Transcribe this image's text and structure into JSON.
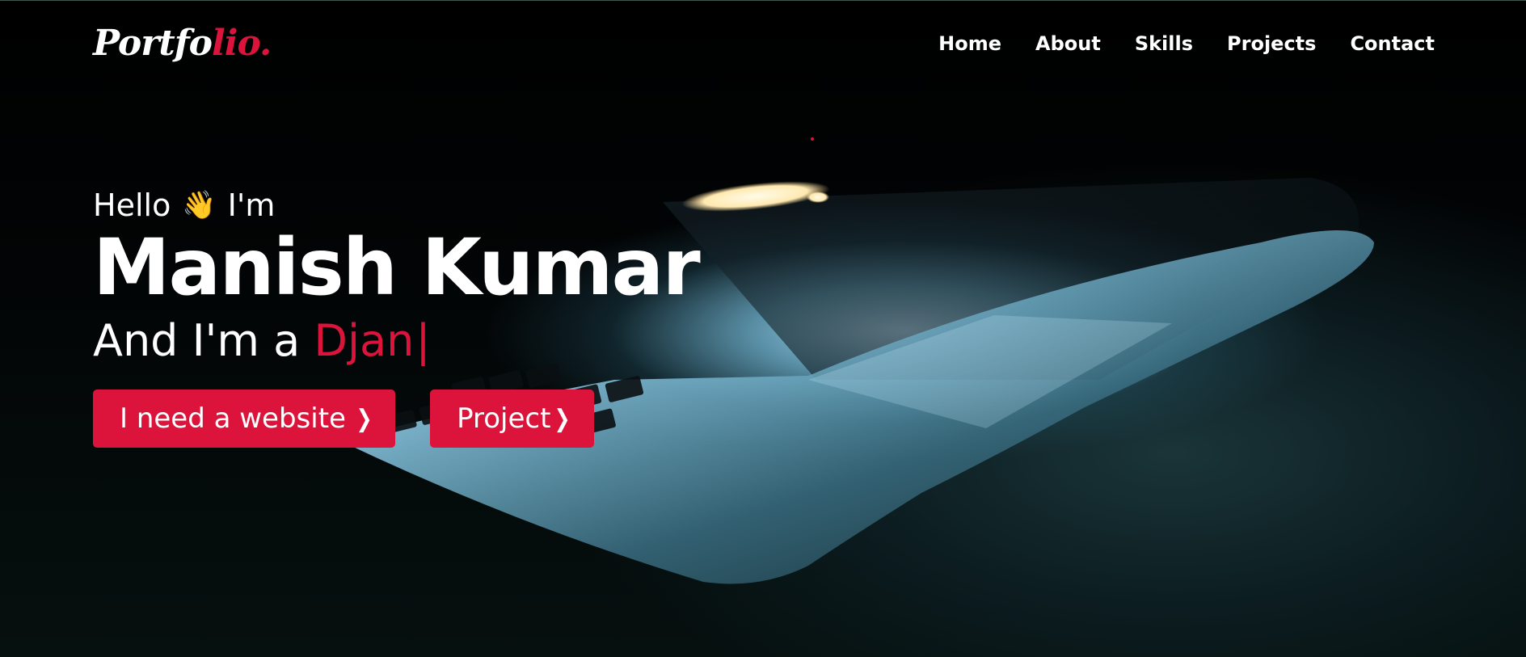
{
  "navbar": {
    "logo_main": "Portfo",
    "logo_accent": "lio.",
    "links": [
      {
        "label": "Home"
      },
      {
        "label": "About"
      },
      {
        "label": "Skills"
      },
      {
        "label": "Projects"
      },
      {
        "label": "Contact"
      }
    ]
  },
  "hero": {
    "greeting_before": "Hello",
    "greeting_icon": "waving-hand-icon",
    "greeting_after": "I'm",
    "name": "Manish Kumar",
    "role_prefix": "And I'm a",
    "role_typed": "Djan",
    "cursor": "|",
    "buttons": {
      "website": "I need a website",
      "project": "Project"
    }
  },
  "colors": {
    "accent": "#dc143c",
    "background": "#000000",
    "text": "#ffffff"
  }
}
